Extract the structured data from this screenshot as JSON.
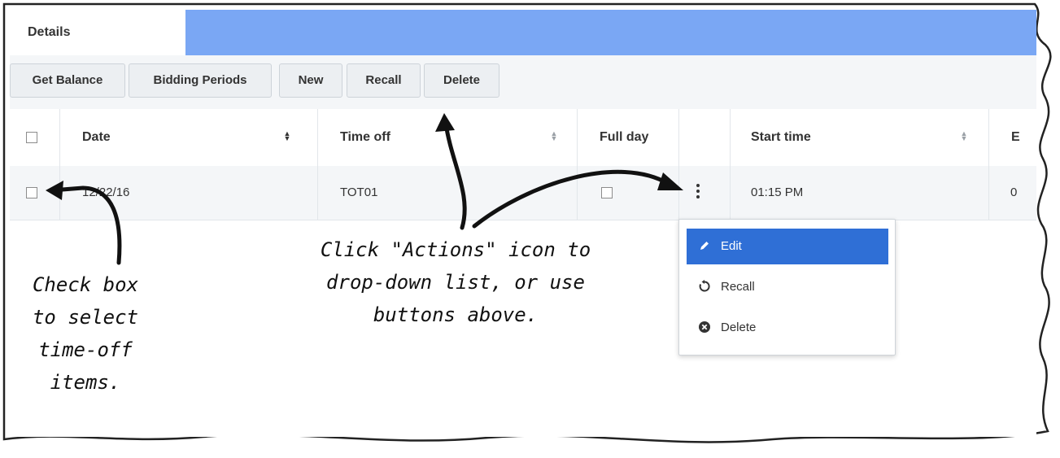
{
  "tabs": {
    "details": "Details"
  },
  "toolbar": {
    "get_balance": "Get Balance",
    "bidding_periods": "Bidding Periods",
    "new": "New",
    "recall": "Recall",
    "delete": "Delete"
  },
  "table": {
    "columns": {
      "date": "Date",
      "time_off": "Time off",
      "full_day": "Full day",
      "start_time": "Start time",
      "end_partial": "E"
    },
    "rows": [
      {
        "date": "12/22/16",
        "time_off": "TOT01",
        "start_time": "01:15 PM",
        "end_partial": "0"
      }
    ]
  },
  "actions_menu": {
    "items": [
      {
        "label": "Edit",
        "icon": "pencil-icon",
        "active": true
      },
      {
        "label": "Recall",
        "icon": "recall-icon",
        "active": false
      },
      {
        "label": "Delete",
        "icon": "delete-circle-icon",
        "active": false
      }
    ]
  },
  "annotations": {
    "checkbox_note": [
      "Check box",
      "to select",
      "time-off",
      "items."
    ],
    "actions_note": [
      "Click \"Actions\" icon to",
      "drop-down list, or use",
      "buttons above."
    ]
  },
  "colors": {
    "tab_bar": "#7aa7f4",
    "menu_active": "#2f6fd6",
    "toolbar_bg": "#f4f6f8"
  }
}
